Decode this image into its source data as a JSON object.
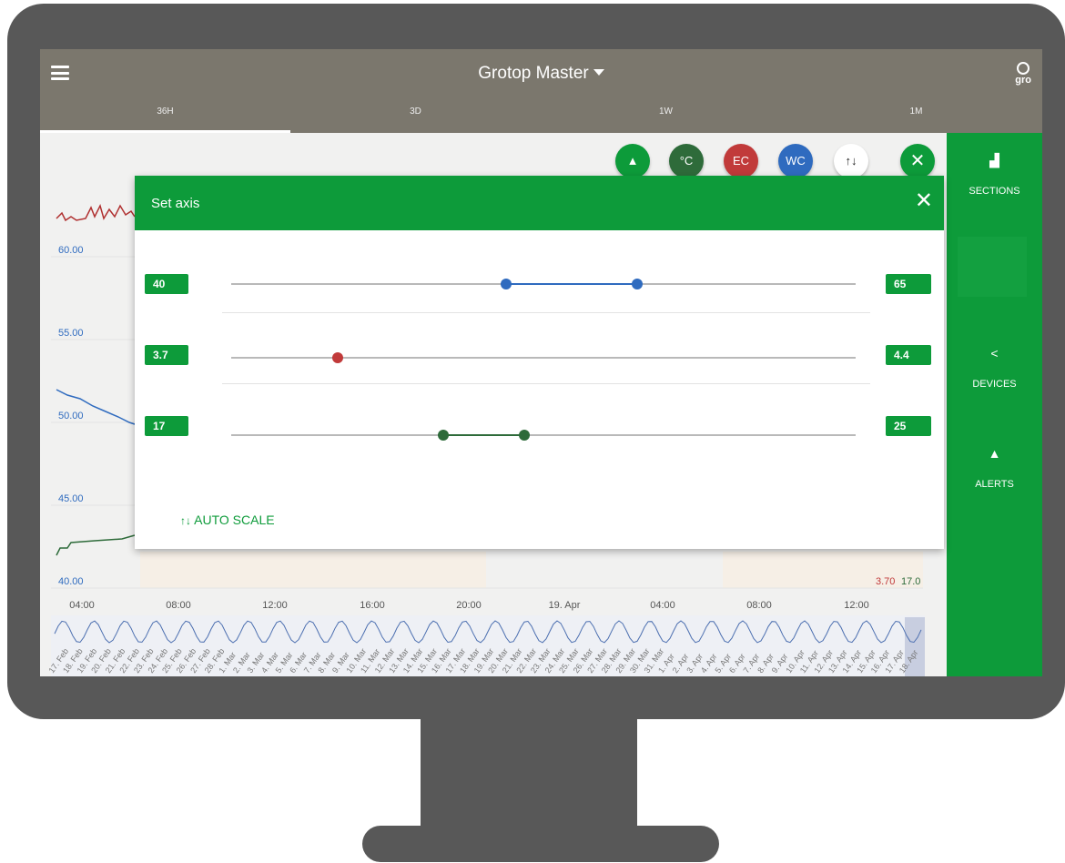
{
  "header": {
    "title": "Grotop Master",
    "logo_text": "gro"
  },
  "tabs": [
    {
      "label": "36H",
      "active": true
    },
    {
      "label": "3D"
    },
    {
      "label": "1W"
    },
    {
      "label": "1M"
    }
  ],
  "toolbar": {
    "buttons": [
      {
        "id": "alerts",
        "label": "",
        "icon": "bell-icon",
        "color": "#0d9b3a"
      },
      {
        "id": "temp",
        "label": "°C",
        "color": "#2e6b3a"
      },
      {
        "id": "ec",
        "label": "EC",
        "color": "#c13a3a"
      },
      {
        "id": "wc",
        "label": "WC",
        "color": "#2f6bbf"
      },
      {
        "id": "axis",
        "label": "↑↓",
        "color": "#ffffff"
      },
      {
        "id": "close",
        "label": "✕",
        "color": "#0d9b3a"
      }
    ]
  },
  "sidebar": {
    "items": [
      {
        "label": "SECTIONS",
        "icon": "bar-chart-icon"
      },
      {
        "label": "DEVICES",
        "icon": "share-icon"
      },
      {
        "label": "ALERTS",
        "icon": "bell-icon"
      }
    ]
  },
  "chart": {
    "y_labels": [
      "60.00",
      "55.00",
      "50.00",
      "45.00",
      "40.00"
    ],
    "x_labels": [
      "04:00",
      "08:00",
      "12:00",
      "16:00",
      "20:00",
      "19. Apr",
      "04:00",
      "08:00",
      "12:00"
    ],
    "right_values": [
      "3.70",
      "17.0"
    ],
    "nav_labels": [
      "17. Feb",
      "18. Feb",
      "19. Feb",
      "20. Feb",
      "21. Feb",
      "22. Feb",
      "23. Feb",
      "24. Feb",
      "25. Feb",
      "26. Feb",
      "27. Feb",
      "28. Feb",
      "1. Mar",
      "2. Mar",
      "3. Mar",
      "4. Mar",
      "5. Mar",
      "6. Mar",
      "7. Mar",
      "8. Mar",
      "9. Mar",
      "10. Mar",
      "11. Mar",
      "12. Mar",
      "13. Mar",
      "14. Mar",
      "15. Mar",
      "16. Mar",
      "17. Mar",
      "18. Mar",
      "19. Mar",
      "20. Mar",
      "21. Mar",
      "22. Mar",
      "23. Mar",
      "24. Mar",
      "25. Mar",
      "26. Mar",
      "27. Mar",
      "28. Mar",
      "29. Mar",
      "30. Mar",
      "31. Mar",
      "1. Apr",
      "2. Apr",
      "3. Apr",
      "4. Apr",
      "5. Apr",
      "6. Apr",
      "7. Apr",
      "8. Apr",
      "9. Apr",
      "10. Apr",
      "11. Apr",
      "12. Apr",
      "13. Apr",
      "14. Apr",
      "15. Apr",
      "16. Apr",
      "17. Apr",
      "18. Apr"
    ]
  },
  "modal": {
    "title": "Set axis",
    "close": "✕",
    "rows": [
      {
        "min": "40",
        "max": "65",
        "color": "#2f6bbf",
        "low": 0.44,
        "high": 0.65
      },
      {
        "min": "3.7",
        "max": "4.4",
        "color": "#c13a3a",
        "low": 0.17,
        "high": 0.17
      },
      {
        "min": "17",
        "max": "25",
        "color": "#2e6b3a",
        "low": 0.34,
        "high": 0.47
      }
    ],
    "auto_scale": "AUTO SCALE",
    "auto_icon": "↑↓"
  }
}
